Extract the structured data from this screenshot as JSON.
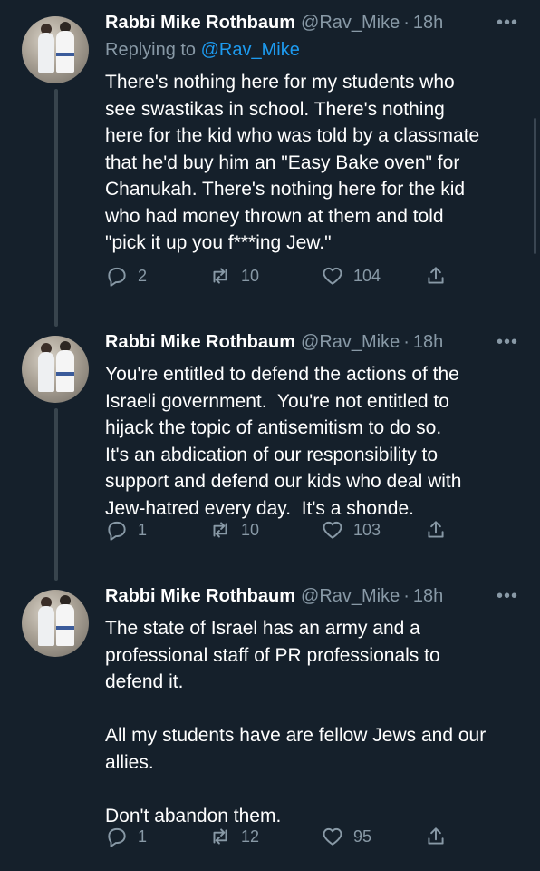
{
  "tweets": [
    {
      "author": {
        "name": "Rabbi Mike Rothbaum",
        "handle": "@Rav_Mike",
        "time": "18h"
      },
      "replying_to_prefix": "Replying to",
      "replying_to_handle": "@Rav_Mike",
      "text": "There's nothing here for my students who\nsee swastikas in school. There's nothing\nhere for the kid who was told by a classmate\nthat he'd buy him an \"Easy Bake oven\" for\nChanukah. There's nothing here for the kid\nwho had money thrown at them and told\n\"pick it up you f***ing Jew.\"",
      "stats": {
        "replies": "2",
        "retweets": "10",
        "likes": "104"
      }
    },
    {
      "author": {
        "name": "Rabbi Mike Rothbaum",
        "handle": "@Rav_Mike",
        "time": "18h"
      },
      "text": "You're entitled to defend the actions of the\nIsraeli government.  You're not entitled to\nhijack the topic of antisemitism to do so.\nIt's an abdication of our responsibility to\nsupport and defend our kids who deal with\nJew-hatred every day.  It's a shonde.",
      "stats": {
        "replies": "1",
        "retweets": "10",
        "likes": "103"
      }
    },
    {
      "author": {
        "name": "Rabbi Mike Rothbaum",
        "handle": "@Rav_Mike",
        "time": "18h"
      },
      "text": "The state of Israel has an army and a\nprofessional staff of PR professionals to\ndefend it.\n\nAll my students have are fellow Jews and our\nallies.\n\nDon't abandon them.",
      "stats": {
        "replies": "1",
        "retweets": "12",
        "likes": "95"
      }
    }
  ],
  "colors": {
    "background": "#15202b",
    "secondary_text": "#8899a6",
    "link": "#1d9bf0",
    "thread_line": "#38444d"
  },
  "icons": [
    "reply-icon",
    "retweet-icon",
    "like-icon",
    "share-icon",
    "more-icon"
  ],
  "separator": "·",
  "more_glyph": "•••"
}
